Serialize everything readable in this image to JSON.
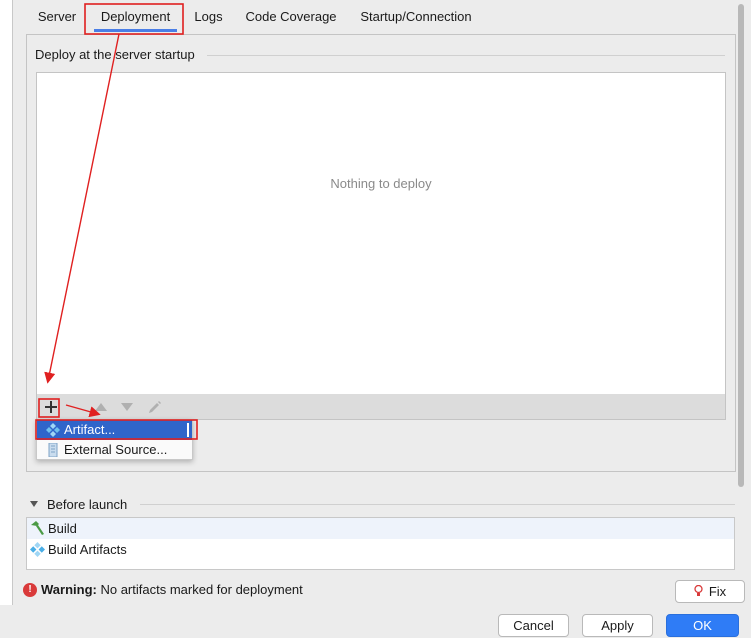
{
  "tabs": [
    {
      "label": "Server"
    },
    {
      "label": "Deployment"
    },
    {
      "label": "Logs"
    },
    {
      "label": "Code Coverage"
    },
    {
      "label": "Startup/Connection"
    }
  ],
  "deploy_group": {
    "title": "Deploy at the server startup",
    "empty_text": "Nothing to deploy"
  },
  "popup_menu": {
    "items": [
      {
        "label": "Artifact...",
        "icon": "artifact-icon"
      },
      {
        "label": "External Source...",
        "icon": "external-source-icon"
      }
    ]
  },
  "before_launch": {
    "title": "Before launch",
    "items": [
      {
        "label": "Build",
        "icon": "hammer-icon"
      },
      {
        "label": "Build Artifacts",
        "icon": "artifact-icon"
      }
    ]
  },
  "warning": {
    "label": "Warning:",
    "message": "No artifacts marked for deployment"
  },
  "buttons": {
    "fix": "Fix",
    "cancel": "Cancel",
    "apply": "Apply",
    "ok": "OK"
  },
  "colors": {
    "accent": "#2f7cf6",
    "selection": "#2f65ca",
    "annotation": "#e02020",
    "warning": "#d93a3a"
  }
}
